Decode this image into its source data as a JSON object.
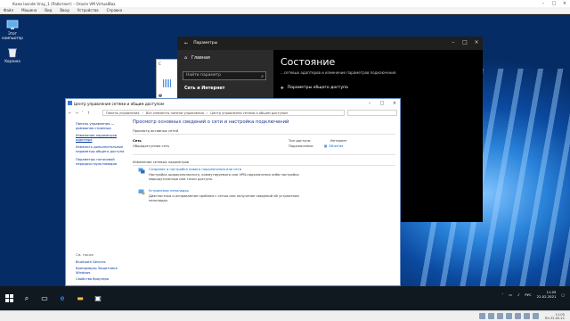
{
  "vbox": {
    "title": "Кали lasnde Vray_1 (Работает) – Oracle VM VirtualBox",
    "menu": [
      "Файл",
      "Машина",
      "Вид",
      "Ввод",
      "Устройства",
      "Справка"
    ]
  },
  "desktop": {
    "icons": [
      {
        "label": "Этот компьютер",
        "icon": "computer-icon"
      },
      {
        "label": "Корзина",
        "icon": "recycle-bin-icon"
      }
    ]
  },
  "settings": {
    "title": "Параметры",
    "home": "Главная",
    "search_placeholder": "Найти параметр",
    "section": "Сеть и Интернет",
    "heading": "Состояние",
    "description": "...сетевых адаптеров и изменение параметров подключения.",
    "sharing_link": "Параметры общего доступа"
  },
  "bgwin": {
    "letter": "С",
    "label": "Ф"
  },
  "nsc": {
    "title": "Центр управления сетями и общим доступом",
    "breadcrumb": [
      "Панель управления",
      "Все элементы панели управления",
      "Центр управления сетями и общим доступом"
    ],
    "side_links": [
      "Панель управления — домашняя страница",
      "Изменение параметров адаптера",
      "Изменить дополнительные параметры общего доступа",
      "Параметры потоковой передачи мультимедиа"
    ],
    "see_also_title": "См. также",
    "see_also": [
      "Bluetooth Devices",
      "Брандмауэр Защитника Windows",
      "Свойства браузера"
    ],
    "heading": "Просмотр основных сведений о сети и настройка подключений",
    "active_networks": "Просмотр активных сетей",
    "network_name": "Сеть",
    "network_type": "Общедоступная сеть",
    "access_type_label": "Тип доступа:",
    "access_type_value": "Интернет",
    "connections_label": "Подключения:",
    "connections_value": "Ethernet",
    "change_settings": "Изменение сетевых параметров",
    "task1_title": "Создание и настройка нового подключения или сети",
    "task1_desc": "Настройка широкополосного, коммутируемого или VPN-подключения либо настройка маршрутизатора или точки доступа.",
    "task2_title": "Устранение неполадок",
    "task2_desc": "Диагностика и исправление проблем с сетью или получение сведений об устранении неполадок."
  },
  "taskbar": {
    "lang": "РУС",
    "time": "11:05",
    "date": "22.02.2021"
  },
  "host_tray": {
    "time": "11:05",
    "date": "Пн 22.02.21"
  }
}
